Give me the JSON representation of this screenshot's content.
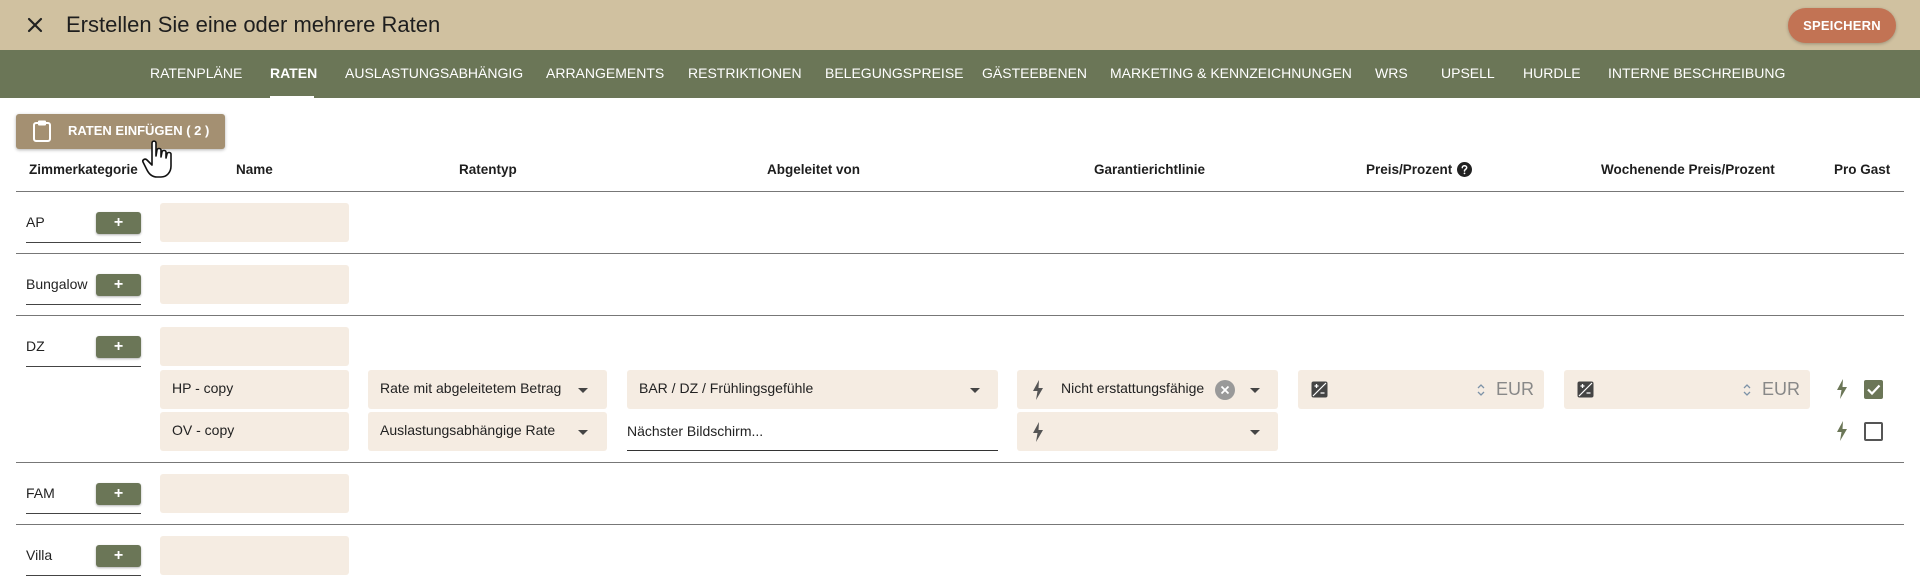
{
  "header": {
    "title": "Erstellen Sie eine oder mehrere Raten",
    "save_label": "SPEICHERN"
  },
  "nav": {
    "items": [
      {
        "label": "RATENPLÄNE"
      },
      {
        "label": "RATEN",
        "active": true
      },
      {
        "label": "AUSLASTUNGSABHÄNGIG"
      },
      {
        "label": "ARRANGEMENTS"
      },
      {
        "label": "RESTRIKTIONEN"
      },
      {
        "label": "BELEGUNGSPREISE"
      },
      {
        "label": "GÄSTEEBENEN"
      },
      {
        "label": "MARKETING & KENNZEICHNUNGEN"
      },
      {
        "label": "WRS"
      },
      {
        "label": "UPSELL"
      },
      {
        "label": "HURDLE"
      },
      {
        "label": "INTERNE BESCHREIBUNG"
      }
    ]
  },
  "toolbar": {
    "paste_label": "RATEN EINFÜGEN ( 2 )"
  },
  "columns": {
    "category": "Zimmerkategorie",
    "name": "Name",
    "rate_type": "Ratentyp",
    "derived_from": "Abgeleitet von",
    "guarantee": "Garantierichtlinie",
    "price": "Preis/Prozent",
    "weekend_price": "Wochenende Preis/Prozent",
    "per_guest": "Pro Gast"
  },
  "categories": [
    {
      "label": "AP"
    },
    {
      "label": "Bungalow"
    },
    {
      "label": "DZ"
    },
    {
      "label": "FAM"
    },
    {
      "label": "Villa"
    }
  ],
  "add_label": "+",
  "dz_rates": [
    {
      "name": "HP - copy",
      "rate_type": "Rate mit abgeleitetem Betrag",
      "derived_from": "BAR / DZ / Frühlingsgefühle",
      "guarantee": "Nicht erstattungsfähige",
      "currency": "EUR",
      "weekend_currency": "EUR",
      "per_guest": true
    },
    {
      "name": "OV - copy",
      "rate_type": "Auslastungsabhängige Rate",
      "derived_from": "Nächster Bildschirm...",
      "guarantee": "",
      "per_guest": false
    }
  ],
  "icons": {
    "close": "close-icon",
    "paste": "clipboard-icon",
    "help": "help-icon",
    "bolt": "bolt-icon",
    "calc": "calculator-icon",
    "clear": "clear-icon"
  },
  "colors": {
    "header_bg": "#d0c1a0",
    "nav_bg": "#6b7657",
    "accent_button": "#c27354",
    "paste_button": "#a49072",
    "field_bg": "#f5ece2"
  }
}
